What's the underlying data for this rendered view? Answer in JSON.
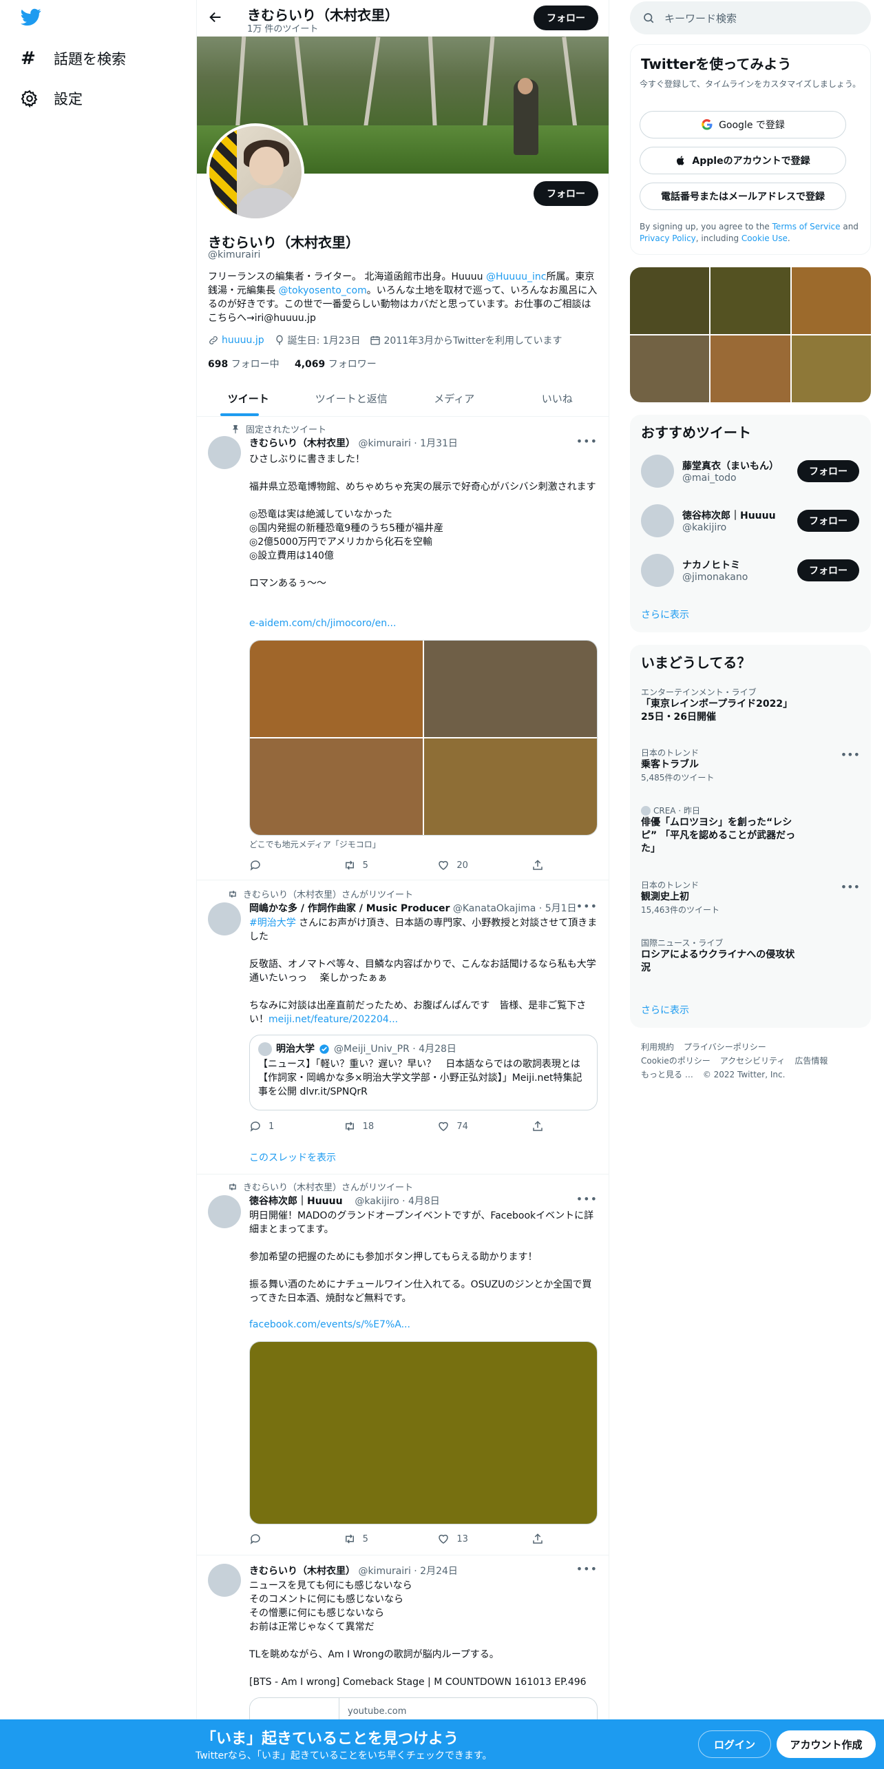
{
  "nav": {
    "explore": "話題を検索",
    "settings": "設定"
  },
  "header": {
    "name": "きむらいり（木村衣里）",
    "tweet_count": "1万 件のツイート",
    "follow": "フォロー"
  },
  "profile": {
    "name": "きむらいり（木村衣里）",
    "handle": "@kimurairi",
    "follow": "フォロー",
    "bio_1": "フリーランスの編集者・ライター。 北海道函館市出身。Huuuu ",
    "bio_link1": "@Huuuu_inc",
    "bio_2": "所属。東京銭湯・元編集長 ",
    "bio_link2": "@tokyosento_com",
    "bio_3": "。いろんな土地を取材で巡って、いろんなお風呂に入るのが好きです。この世で一番愛らしい動物はカバだと思っています。お仕事のご相談はこちらへ→iri@huuuu.jp",
    "website": "huuuu.jp",
    "birthday": "誕生日: 1月23日",
    "joined": "2011年3月からTwitterを利用しています",
    "following_count": "698",
    "following_label": "フォロー中",
    "followers_count": "4,069",
    "followers_label": "フォロワー"
  },
  "tabs": [
    "ツイート",
    "ツイートと返信",
    "メディア",
    "いいね"
  ],
  "tweets": [
    {
      "social": "固定されたツイート",
      "name": "きむらいり（木村衣里）",
      "meta": "@kimurairi · 1月31日",
      "body": "ひさしぶりに書きました！\n\n福井県立恐竜博物館、めちゃめちゃ充実の展示で好奇心がバシバシ刺激されます\n\n◎恐竜は実は絶滅していなかった\n◎国内発掘の新種恐竜9種のうち5種が福井産\n◎2億5000万円でアメリカから化石を空輸\n◎設立費用は140億\n\nロマンあるぅ〜〜",
      "link": "e-aidem.com/ch/jimocoro/en...",
      "caption": "どこでも地元メディア「ジモコロ」",
      "reply": "",
      "retweet": "5",
      "like": "20",
      "media_colors": [
        "#a0662a",
        "#6f5f47",
        "#94683c",
        "#8e6e36"
      ]
    },
    {
      "social": "きむらいり（木村衣里）さんがリツイート",
      "name": "岡嶋かな多 / 作詞作曲家 / Music Producer",
      "meta": "@KanataOkajima · 5月1日",
      "body_link": "#明治大学",
      "body": " さんにお声がけ頂き、日本語の専門家、小野教授と対談させて頂きました\n\n反敬語、オノマトペ等々、目鱗な内容ばかりで、こんなお話聞けるなら私も大学通いたいっっ　 楽しかったぁぁ\n\nちなみに対談は出産直前だったため、お腹ぱんぱんです　皆様、是非ご覧下さい！",
      "body_link2": "meiji.net/feature/202204...",
      "quote_name": "明治大学",
      "quote_meta": "@Meiji_Univ_PR · 4月28日",
      "quote_body": "【ニュース】「軽い？重い？遅い？早い？　日本語ならではの歌詞表現とは【作詞家・岡嶋かな多×明治大学文学部・小野正弘対談】」Meiji.net特集記事を公開 dlvr.it/SPNQrR",
      "reply": "1",
      "retweet": "18",
      "like": "74",
      "show_thread": "このスレッドを表示"
    },
    {
      "social": "きむらいり（木村衣里）さんがリツイート",
      "name": "徳谷柿次郎｜Huuuu",
      "meta": "@kakijiro · 4月8日",
      "body": "明日開催！MADOのグランドオープンイベントですが、Facebookイベントに詳細まとまってます。\n\n参加希望の把握のためにも参加ボタン押してもらえる助かります！\n\n振る舞い酒のためにナチュールワイン仕入れてる。OSUZUのジンとか全国で買ってきた日本酒、焼酎など無料です。",
      "link": "facebook.com/events/s/%E7%A...",
      "reply": "",
      "retweet": "5",
      "like": "13",
      "media_color": "#777010"
    },
    {
      "name": "きむらいり（木村衣里）",
      "meta": "@kimurairi · 2月24日",
      "body": "ニュースを見ても何にも感じないなら\nそのコメントに何にも感じないなら\nその憎悪に何にも感じないなら\nお前は正常じゃなくて異常だ\n\nTLを眺めながら、Am I Wrongの歌詞が脳内ループする。\n\n[BTS - Am I wrong] Comeback Stage | M COUNTDOWN 161013 EP.496",
      "card_domain": "youtube.com"
    }
  ],
  "search": {
    "placeholder": "キーワード検索"
  },
  "signup": {
    "title": "Twitterを使ってみよう",
    "subtitle": "今すぐ登録して、タイムラインをカスタマイズしましょう。",
    "google": "Google で登録",
    "apple": "Appleのアカウントで登録",
    "phone": "電話番号またはメールアドレスで登録",
    "terms_1": "By signing up, you agree to the ",
    "terms_link1": "Terms of Service",
    "terms_2": " and ",
    "terms_link2": "Privacy Policy",
    "terms_3": ", including ",
    "terms_link3": "Cookie Use",
    "terms_4": "."
  },
  "photo_colors": [
    "#4e4b22",
    "#545222",
    "#9c6a2c",
    "#726244",
    "#9a6a36",
    "#8e7838"
  ],
  "recommended": {
    "title": "おすすめツイート",
    "users": [
      {
        "name": "藤堂真衣（まいもん）",
        "handle": "@mai_todo",
        "button": "フォロー"
      },
      {
        "name": "徳谷柿次郎｜Huuuu",
        "handle": "@kakijiro",
        "button": "フォロー"
      },
      {
        "name": "ナカノヒトミ",
        "handle": "@jimonakano",
        "button": "フォロー"
      }
    ],
    "show_more": "さらに表示"
  },
  "trends": {
    "title": "いまどうしてる？",
    "items": [
      {
        "category": "エンターテインメント・ライブ",
        "title": "「東京レインボープライド2022」 25日・26日開催",
        "count": ""
      },
      {
        "category": "日本のトレンド",
        "title": "乗客トラブル",
        "count": "5,485件のツイート"
      },
      {
        "category": "CREA · 昨日",
        "title": "俳優「ムロツヨシ」を創った“レシピ” 「平凡を認めることが武器だった」",
        "count": ""
      },
      {
        "category": "日本のトレンド",
        "title": "観測史上初",
        "count": "15,463件のツイート"
      },
      {
        "category": "国際ニュース・ライブ",
        "title": "ロシアによるウクライナへの侵攻状況",
        "count": ""
      }
    ],
    "show_more": "さらに表示"
  },
  "footer": {
    "links": [
      "利用規約",
      "プライバシーポリシー",
      "Cookieのポリシー",
      "アクセシビリティ",
      "広告情報",
      "もっと見る …"
    ],
    "copyright": "© 2022 Twitter, Inc."
  },
  "bottom_bar": {
    "title": "「いま」起きていることを見つけよう",
    "subtitle": "Twitterなら、「いま」起きていることをいち早くチェックできます。",
    "login": "ログイン",
    "signup": "アカウント作成"
  },
  "colors": {
    "accent": "#1d9bf0",
    "text": "#0f1419",
    "muted": "#536471"
  }
}
